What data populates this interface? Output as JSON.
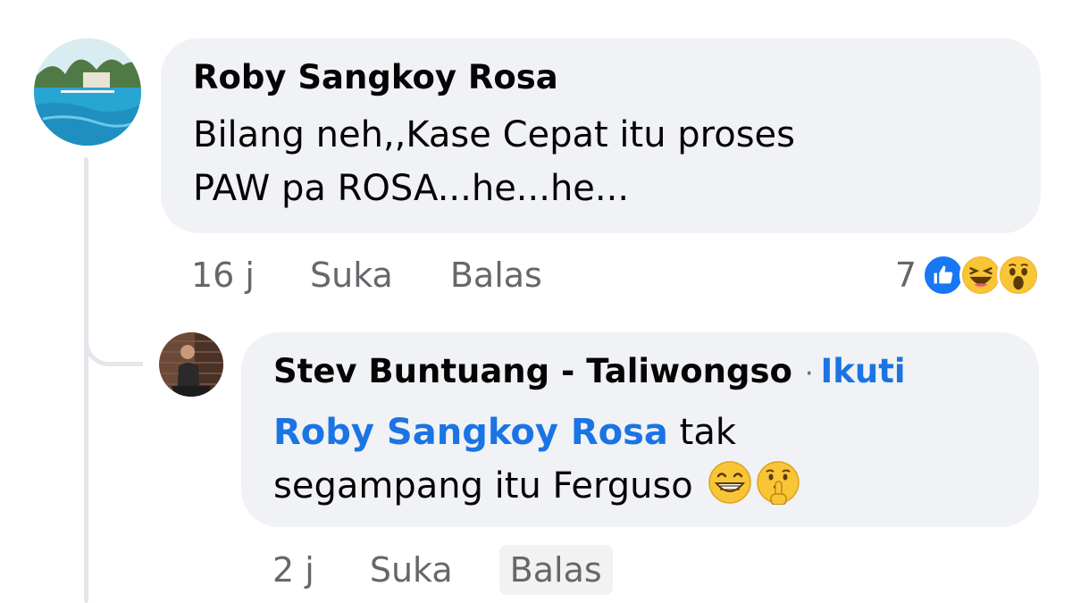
{
  "comment": {
    "author": "Roby Sangkoy Rosa",
    "text_line1": "Bilang neh,,Kase Cepat itu proses",
    "text_line2": "PAW pa ROSA...he...he...",
    "time": "16 j",
    "like_label": "Suka",
    "reply_label": "Balas",
    "reaction_count": "7",
    "reactions": [
      "like-icon",
      "haha-icon",
      "wow-icon"
    ]
  },
  "reply": {
    "author": "Stev Buntuang - Taliwongso",
    "separator": "·",
    "follow_label": "Ikuti",
    "mention": "Roby Sangkoy Rosa",
    "text_after_mention": " tak",
    "text_line2": "segampang itu Ferguso",
    "emojis": [
      "grinning-emoji",
      "shushing-emoji"
    ],
    "time": "2 j",
    "like_label": "Suka",
    "reply_label": "Balas"
  },
  "colors": {
    "bubble": "#f0f2f5",
    "link": "#1b74e4",
    "meta": "#65676b"
  }
}
